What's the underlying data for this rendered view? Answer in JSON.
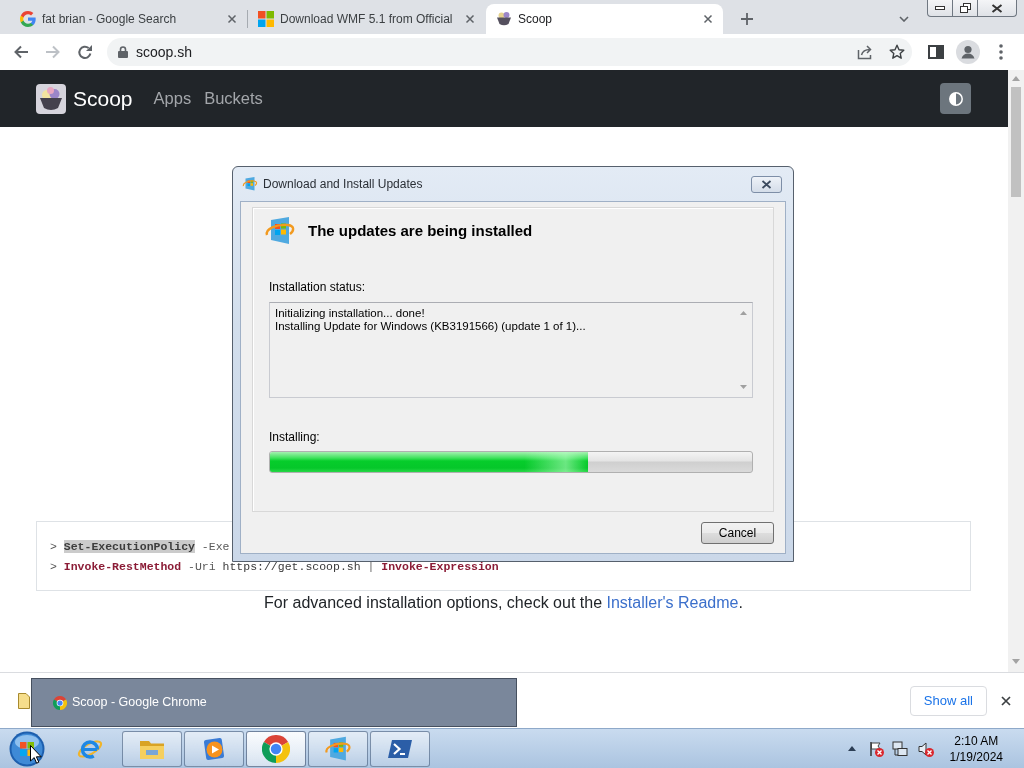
{
  "browser": {
    "tabs": [
      {
        "title": "fat brian - Google Search",
        "kind": "google",
        "selected": false
      },
      {
        "title": "Download WMF 5.1 from Official",
        "kind": "microsoft",
        "selected": false
      },
      {
        "title": "Scoop",
        "kind": "scoop",
        "selected": true
      }
    ],
    "nav_buttons": [
      {
        "kind": "back",
        "disabled": false
      },
      {
        "kind": "forward",
        "disabled": true
      },
      {
        "kind": "reload",
        "disabled": false
      }
    ],
    "address": "scoop.sh"
  },
  "site": {
    "brand": "Scoop",
    "nav_links": [
      "Apps",
      "Buckets"
    ],
    "code_lines": [
      {
        "prompt": ">",
        "tokens": [
          {
            "text": "Set-ExecutionPolicy",
            "kind": "cmdlet",
            "selected": true
          },
          {
            "text": "-Exe",
            "kind": "param",
            "selected": false
          }
        ]
      },
      {
        "prompt": ">",
        "tokens": [
          {
            "text": "Invoke-RestMethod",
            "kind": "cmdlet",
            "selected": false
          },
          {
            "text": "-Uri",
            "kind": "param",
            "selected": false
          },
          {
            "text": "https://get.scoop.sh",
            "kind": "value",
            "selected": false
          },
          {
            "text": "|",
            "kind": "operator",
            "selected": false
          },
          {
            "text": "Invoke-Expression",
            "kind": "cmdlet",
            "selected": false
          }
        ]
      }
    ],
    "note": {
      "text": "For advanced installation options, check out the",
      "link": "Installer's Readme",
      "end": "."
    }
  },
  "dialog": {
    "title": "Download and Install Updates",
    "heading": "The updates are being installed",
    "status_label": "Installation status:",
    "log": [
      "Initializing installation... done!",
      "Installing Update for Windows (KB3191566) (update 1 of 1)..."
    ],
    "progress_label": "Installing:",
    "progress": {
      "level": 0.66
    },
    "buttons": [
      "Cancel"
    ]
  },
  "download_bar": {
    "show_all": "Show all"
  },
  "tooltip": {
    "title": "Scoop - Google Chrome"
  },
  "taskbar": {
    "apps": [
      {
        "kind": "ie",
        "running": false,
        "selected": false
      },
      {
        "kind": "explorer",
        "running": true,
        "selected": false
      },
      {
        "kind": "media",
        "running": true,
        "selected": false
      },
      {
        "kind": "chrome",
        "running": true,
        "selected": true
      },
      {
        "kind": "update",
        "running": true,
        "selected": false
      },
      {
        "kind": "powershell",
        "running": true,
        "selected": false
      }
    ],
    "clock": {
      "time": "2:10 AM",
      "date": "1/19/2024"
    }
  }
}
